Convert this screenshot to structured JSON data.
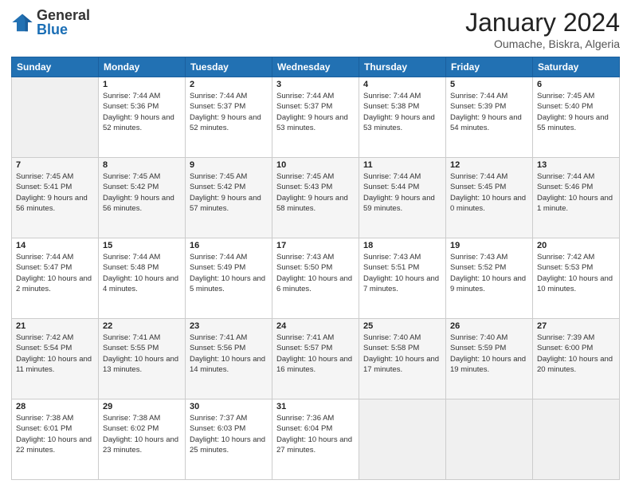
{
  "logo": {
    "general": "General",
    "blue": "Blue"
  },
  "header": {
    "month": "January 2024",
    "location": "Oumache, Biskra, Algeria"
  },
  "days_of_week": [
    "Sunday",
    "Monday",
    "Tuesday",
    "Wednesday",
    "Thursday",
    "Friday",
    "Saturday"
  ],
  "weeks": [
    [
      {
        "day": "",
        "sunrise": "",
        "sunset": "",
        "daylight": ""
      },
      {
        "day": "1",
        "sunrise": "Sunrise: 7:44 AM",
        "sunset": "Sunset: 5:36 PM",
        "daylight": "Daylight: 9 hours and 52 minutes."
      },
      {
        "day": "2",
        "sunrise": "Sunrise: 7:44 AM",
        "sunset": "Sunset: 5:37 PM",
        "daylight": "Daylight: 9 hours and 52 minutes."
      },
      {
        "day": "3",
        "sunrise": "Sunrise: 7:44 AM",
        "sunset": "Sunset: 5:37 PM",
        "daylight": "Daylight: 9 hours and 53 minutes."
      },
      {
        "day": "4",
        "sunrise": "Sunrise: 7:44 AM",
        "sunset": "Sunset: 5:38 PM",
        "daylight": "Daylight: 9 hours and 53 minutes."
      },
      {
        "day": "5",
        "sunrise": "Sunrise: 7:44 AM",
        "sunset": "Sunset: 5:39 PM",
        "daylight": "Daylight: 9 hours and 54 minutes."
      },
      {
        "day": "6",
        "sunrise": "Sunrise: 7:45 AM",
        "sunset": "Sunset: 5:40 PM",
        "daylight": "Daylight: 9 hours and 55 minutes."
      }
    ],
    [
      {
        "day": "7",
        "sunrise": "Sunrise: 7:45 AM",
        "sunset": "Sunset: 5:41 PM",
        "daylight": "Daylight: 9 hours and 56 minutes."
      },
      {
        "day": "8",
        "sunrise": "Sunrise: 7:45 AM",
        "sunset": "Sunset: 5:42 PM",
        "daylight": "Daylight: 9 hours and 56 minutes."
      },
      {
        "day": "9",
        "sunrise": "Sunrise: 7:45 AM",
        "sunset": "Sunset: 5:42 PM",
        "daylight": "Daylight: 9 hours and 57 minutes."
      },
      {
        "day": "10",
        "sunrise": "Sunrise: 7:45 AM",
        "sunset": "Sunset: 5:43 PM",
        "daylight": "Daylight: 9 hours and 58 minutes."
      },
      {
        "day": "11",
        "sunrise": "Sunrise: 7:44 AM",
        "sunset": "Sunset: 5:44 PM",
        "daylight": "Daylight: 9 hours and 59 minutes."
      },
      {
        "day": "12",
        "sunrise": "Sunrise: 7:44 AM",
        "sunset": "Sunset: 5:45 PM",
        "daylight": "Daylight: 10 hours and 0 minutes."
      },
      {
        "day": "13",
        "sunrise": "Sunrise: 7:44 AM",
        "sunset": "Sunset: 5:46 PM",
        "daylight": "Daylight: 10 hours and 1 minute."
      }
    ],
    [
      {
        "day": "14",
        "sunrise": "Sunrise: 7:44 AM",
        "sunset": "Sunset: 5:47 PM",
        "daylight": "Daylight: 10 hours and 2 minutes."
      },
      {
        "day": "15",
        "sunrise": "Sunrise: 7:44 AM",
        "sunset": "Sunset: 5:48 PM",
        "daylight": "Daylight: 10 hours and 4 minutes."
      },
      {
        "day": "16",
        "sunrise": "Sunrise: 7:44 AM",
        "sunset": "Sunset: 5:49 PM",
        "daylight": "Daylight: 10 hours and 5 minutes."
      },
      {
        "day": "17",
        "sunrise": "Sunrise: 7:43 AM",
        "sunset": "Sunset: 5:50 PM",
        "daylight": "Daylight: 10 hours and 6 minutes."
      },
      {
        "day": "18",
        "sunrise": "Sunrise: 7:43 AM",
        "sunset": "Sunset: 5:51 PM",
        "daylight": "Daylight: 10 hours and 7 minutes."
      },
      {
        "day": "19",
        "sunrise": "Sunrise: 7:43 AM",
        "sunset": "Sunset: 5:52 PM",
        "daylight": "Daylight: 10 hours and 9 minutes."
      },
      {
        "day": "20",
        "sunrise": "Sunrise: 7:42 AM",
        "sunset": "Sunset: 5:53 PM",
        "daylight": "Daylight: 10 hours and 10 minutes."
      }
    ],
    [
      {
        "day": "21",
        "sunrise": "Sunrise: 7:42 AM",
        "sunset": "Sunset: 5:54 PM",
        "daylight": "Daylight: 10 hours and 11 minutes."
      },
      {
        "day": "22",
        "sunrise": "Sunrise: 7:41 AM",
        "sunset": "Sunset: 5:55 PM",
        "daylight": "Daylight: 10 hours and 13 minutes."
      },
      {
        "day": "23",
        "sunrise": "Sunrise: 7:41 AM",
        "sunset": "Sunset: 5:56 PM",
        "daylight": "Daylight: 10 hours and 14 minutes."
      },
      {
        "day": "24",
        "sunrise": "Sunrise: 7:41 AM",
        "sunset": "Sunset: 5:57 PM",
        "daylight": "Daylight: 10 hours and 16 minutes."
      },
      {
        "day": "25",
        "sunrise": "Sunrise: 7:40 AM",
        "sunset": "Sunset: 5:58 PM",
        "daylight": "Daylight: 10 hours and 17 minutes."
      },
      {
        "day": "26",
        "sunrise": "Sunrise: 7:40 AM",
        "sunset": "Sunset: 5:59 PM",
        "daylight": "Daylight: 10 hours and 19 minutes."
      },
      {
        "day": "27",
        "sunrise": "Sunrise: 7:39 AM",
        "sunset": "Sunset: 6:00 PM",
        "daylight": "Daylight: 10 hours and 20 minutes."
      }
    ],
    [
      {
        "day": "28",
        "sunrise": "Sunrise: 7:38 AM",
        "sunset": "Sunset: 6:01 PM",
        "daylight": "Daylight: 10 hours and 22 minutes."
      },
      {
        "day": "29",
        "sunrise": "Sunrise: 7:38 AM",
        "sunset": "Sunset: 6:02 PM",
        "daylight": "Daylight: 10 hours and 23 minutes."
      },
      {
        "day": "30",
        "sunrise": "Sunrise: 7:37 AM",
        "sunset": "Sunset: 6:03 PM",
        "daylight": "Daylight: 10 hours and 25 minutes."
      },
      {
        "day": "31",
        "sunrise": "Sunrise: 7:36 AM",
        "sunset": "Sunset: 6:04 PM",
        "daylight": "Daylight: 10 hours and 27 minutes."
      },
      {
        "day": "",
        "sunrise": "",
        "sunset": "",
        "daylight": ""
      },
      {
        "day": "",
        "sunrise": "",
        "sunset": "",
        "daylight": ""
      },
      {
        "day": "",
        "sunrise": "",
        "sunset": "",
        "daylight": ""
      }
    ]
  ]
}
